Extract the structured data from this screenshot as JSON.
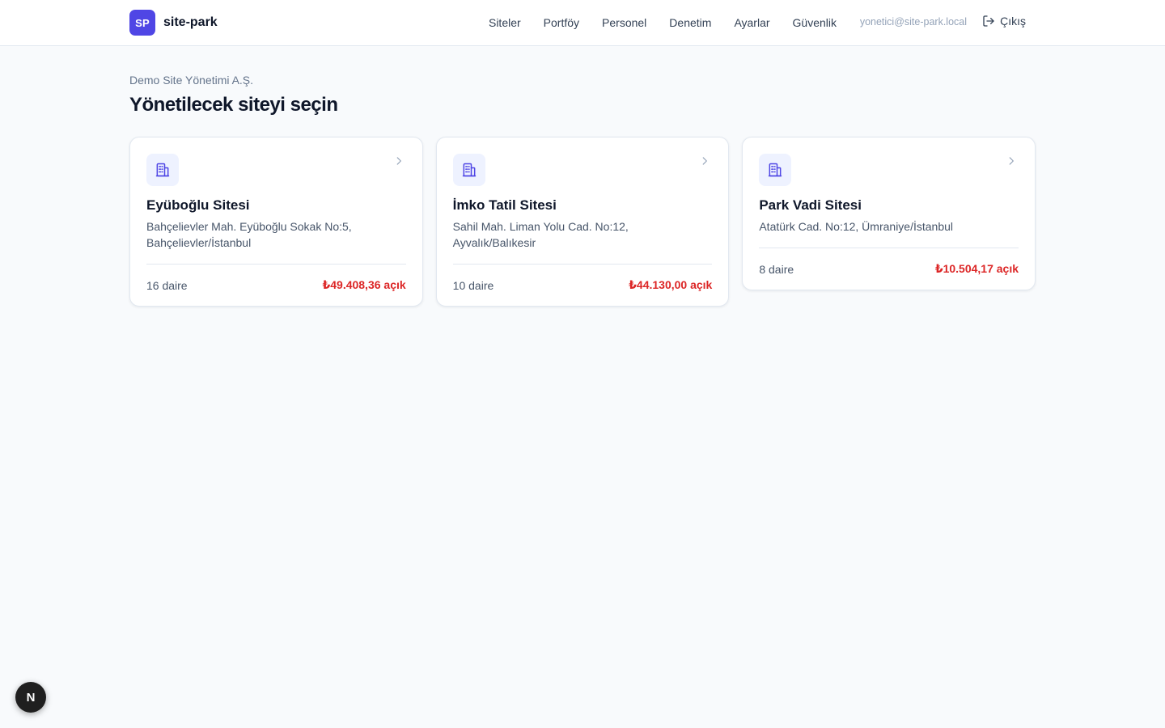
{
  "app": {
    "logo_text": "SP",
    "name": "site-park",
    "brand_color": "#4f46e5"
  },
  "nav": {
    "items": [
      {
        "label": "Siteler"
      },
      {
        "label": "Portföy"
      },
      {
        "label": "Personel"
      },
      {
        "label": "Denetim"
      },
      {
        "label": "Ayarlar"
      },
      {
        "label": "Güvenlik"
      }
    ],
    "user_email": "yonetici@site-park.local",
    "logout_label": "Çıkış"
  },
  "header": {
    "organization": "Demo Site Yönetimi A.Ş.",
    "title": "Yönetilecek siteyi seçin"
  },
  "sites": [
    {
      "name": "Eyüboğlu Sitesi",
      "address": "Bahçelievler Mah. Eyüboğlu Sokak No:5, Bahçelievler/İstanbul",
      "units": "16 daire",
      "balance": "₺49.408,36 açık",
      "icon": "building-icon"
    },
    {
      "name": "İmko Tatil Sitesi",
      "address": "Sahil Mah. Liman Yolu Cad. No:12, Ayvalık/Balıkesir",
      "units": "10 daire",
      "balance": "₺44.130,00 açık",
      "icon": "building-icon"
    },
    {
      "name": "Park Vadi Sitesi",
      "address": "Atatürk Cad. No:12, Ümraniye/İstanbul",
      "units": "8 daire",
      "balance": "₺10.504,17 açık",
      "icon": "building-icon"
    }
  ],
  "dev_badge": {
    "label": "N"
  },
  "colors": {
    "accent": "#4f46e5",
    "balance_open": "#dc2626",
    "background": "#f8fafc"
  }
}
